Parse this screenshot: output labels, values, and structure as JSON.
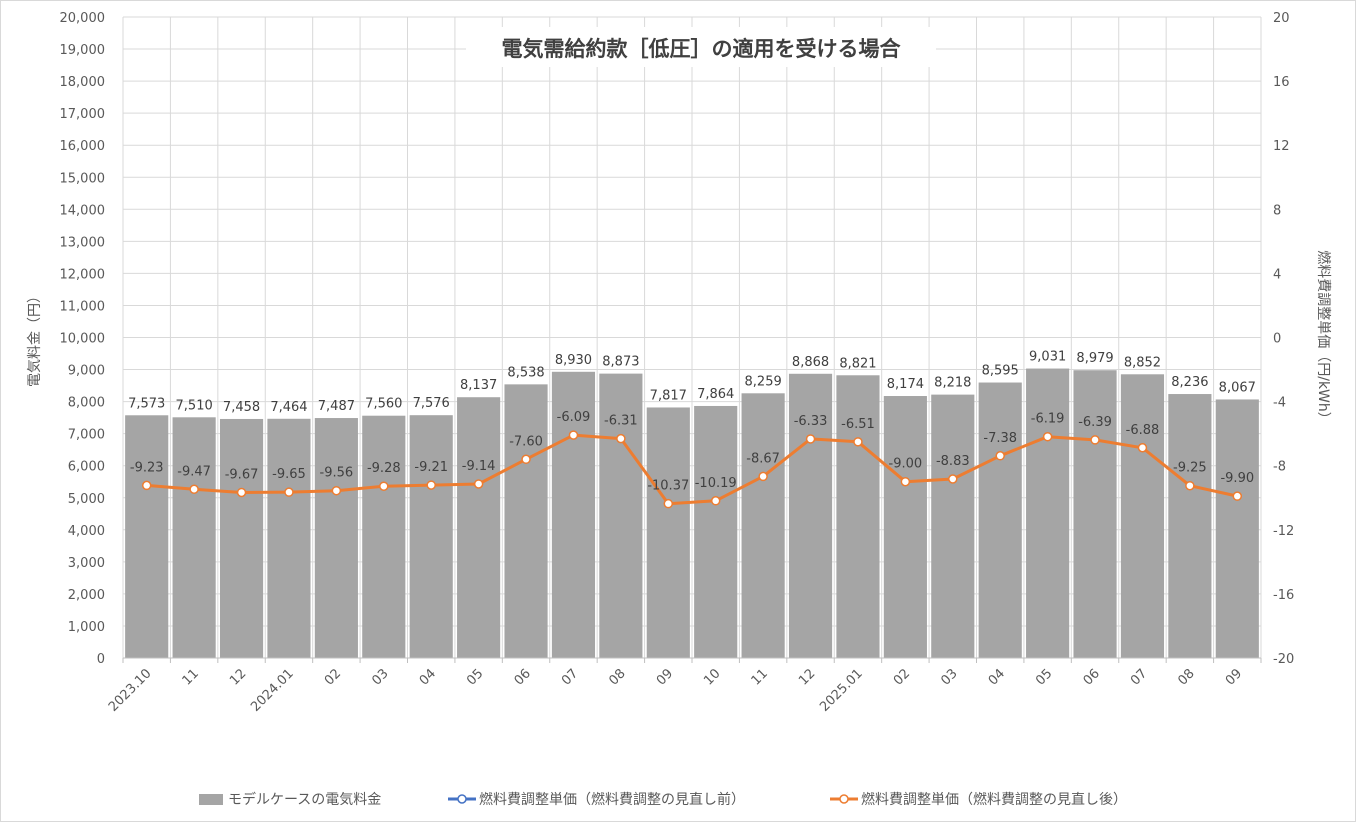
{
  "chart_data": {
    "type": "bar",
    "title": "電気需給約款［低圧］の適用を受ける場合",
    "ylabel_left": "電気料金（円）",
    "ylabel_right": "燃料費調整単価（円/kWh）",
    "ylim_left": [
      0,
      20000
    ],
    "ylim_right": [
      -20,
      20
    ],
    "yticks_left": [
      "0",
      "1,000",
      "2,000",
      "3,000",
      "4,000",
      "5,000",
      "6,000",
      "7,000",
      "8,000",
      "9,000",
      "10,000",
      "11,000",
      "12,000",
      "13,000",
      "14,000",
      "15,000",
      "16,000",
      "17,000",
      "18,000",
      "19,000",
      "20,000"
    ],
    "yticks_right": [
      "-20",
      "-16",
      "-12",
      "-8",
      "-4",
      "0",
      "4",
      "8",
      "12",
      "16",
      "20"
    ],
    "grid": true,
    "legend_position": "bottom",
    "categories": [
      "2023.10",
      "11",
      "12",
      "2024.01",
      "02",
      "03",
      "04",
      "05",
      "06",
      "07",
      "08",
      "09",
      "10",
      "11",
      "12",
      "2025.01",
      "02",
      "03",
      "04",
      "05",
      "06",
      "07",
      "08",
      "09"
    ],
    "series": [
      {
        "name": "モデルケースの電気料金",
        "kind": "bar",
        "axis": "left",
        "color": "#a5a5a5",
        "values": [
          7573,
          7510,
          7458,
          7464,
          7487,
          7560,
          7576,
          8137,
          8538,
          8930,
          8873,
          7817,
          7864,
          8259,
          8868,
          8821,
          8174,
          8218,
          8595,
          9031,
          8979,
          8852,
          8236,
          8067
        ],
        "labels": [
          "7,573",
          "7,510",
          "7,458",
          "7,464",
          "7,487",
          "7,560",
          "7,576",
          "8,137",
          "8,538",
          "8,930",
          "8,873",
          "7,817",
          "7,864",
          "8,259",
          "8,868",
          "8,821",
          "8,174",
          "8,218",
          "8,595",
          "9,031",
          "8,979",
          "8,852",
          "8,236",
          "8,067"
        ]
      },
      {
        "name": "燃料費調整単価（燃料費調整の見直し前）",
        "kind": "line",
        "axis": "right",
        "color": "#4472c4",
        "values": []
      },
      {
        "name": "燃料費調整単価（燃料費調整の見直し後）",
        "kind": "line",
        "axis": "right",
        "color": "#ed7d31",
        "values": [
          -9.23,
          -9.47,
          -9.67,
          -9.65,
          -9.56,
          -9.28,
          -9.21,
          -9.14,
          -7.6,
          -6.09,
          -6.31,
          -10.37,
          -10.19,
          -8.67,
          -6.33,
          -6.51,
          -9.0,
          -8.83,
          -7.38,
          -6.19,
          -6.39,
          -6.88,
          -9.25,
          -9.9
        ],
        "labels": [
          "-9.23",
          "-9.47",
          "-9.67",
          "-9.65",
          "-9.56",
          "-9.28",
          "-9.21",
          "-9.14",
          "-7.60",
          "-6.09",
          "-6.31",
          "-10.37",
          "-10.19",
          "-8.67",
          "-6.33",
          "-6.51",
          "-9.00",
          "-8.83",
          "-7.38",
          "-6.19",
          "-6.39",
          "-6.88",
          "-9.25",
          "-9.90"
        ]
      }
    ]
  }
}
